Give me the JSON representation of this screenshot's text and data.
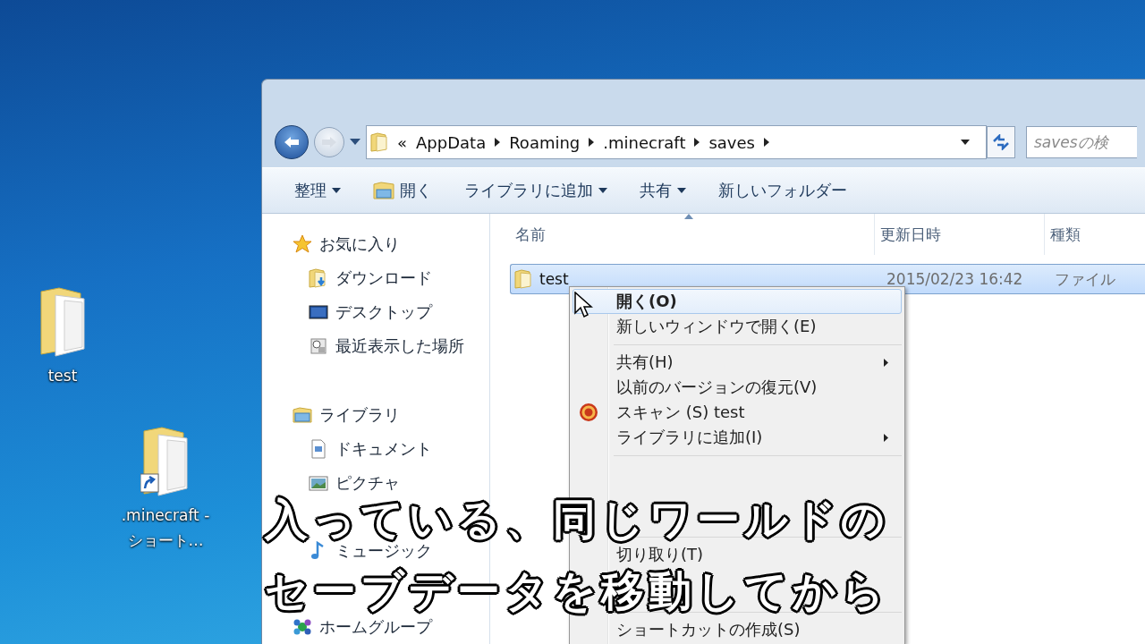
{
  "desktop": {
    "icons": [
      {
        "label": "test",
        "kind": "folder"
      },
      {
        "label": ".minecraft - ショート…",
        "kind": "shortcut"
      }
    ]
  },
  "explorer": {
    "back": {
      "disabled": false
    },
    "forward": {
      "disabled": true
    },
    "address": {
      "overflow": "«",
      "crumbs": [
        "AppData",
        "Roaming",
        ".minecraft",
        "saves"
      ]
    },
    "search": {
      "placeholder": "savesの検"
    },
    "toolbar": [
      {
        "label": "整理",
        "kind": "menu"
      },
      {
        "label": "開く",
        "kind": "open"
      },
      {
        "label": "ライブラリに追加",
        "kind": "menu"
      },
      {
        "label": "共有",
        "kind": "menu"
      },
      {
        "label": "新しいフォルダー",
        "kind": "plain"
      }
    ],
    "nav_pane": [
      {
        "label": "お気に入り",
        "kind": "favorites",
        "children": [
          {
            "label": "ダウンロード",
            "kind": "downloads"
          },
          {
            "label": "デスクトップ",
            "kind": "desktop"
          },
          {
            "label": "最近表示した場所",
            "kind": "recent"
          }
        ]
      },
      {
        "label": "ライブラリ",
        "kind": "libraries",
        "children": [
          {
            "label": "ドキュメント",
            "kind": "documents"
          },
          {
            "label": "ピクチャ",
            "kind": "pictures"
          },
          {
            "kind": "covered"
          },
          {
            "label": "ミュージック",
            "kind": "music"
          }
        ]
      },
      {
        "label": "ホームグループ",
        "kind": "homegroup"
      }
    ],
    "columns": [
      {
        "label": "名前",
        "sorted": true
      },
      {
        "label": "更新日時",
        "sorted": false
      },
      {
        "label": "種類",
        "sorted": false
      }
    ],
    "rows": [
      {
        "name": "test",
        "modified": "2015/02/23 16:42",
        "type": "ファイル",
        "selected": true
      }
    ]
  },
  "context_menu": {
    "items": [
      {
        "kind": "item",
        "label": "開く(O)",
        "default": true,
        "selected": true,
        "submenu": false,
        "has_icon": false
      },
      {
        "kind": "item",
        "label": "新しいウィンドウで開く(E)",
        "default": false,
        "selected": false,
        "submenu": false,
        "has_icon": false
      },
      {
        "kind": "separator"
      },
      {
        "kind": "item",
        "label": "共有(H)",
        "default": false,
        "selected": false,
        "submenu": true,
        "has_icon": false
      },
      {
        "kind": "item",
        "label": "以前のバージョンの復元(V)",
        "default": false,
        "selected": false,
        "submenu": false,
        "has_icon": false
      },
      {
        "kind": "item",
        "label": "スキャン (S) test",
        "default": false,
        "selected": false,
        "submenu": false,
        "has_icon": true
      },
      {
        "kind": "item",
        "label": "ライブラリに追加(I)",
        "default": false,
        "selected": false,
        "submenu": true,
        "has_icon": false
      },
      {
        "kind": "separator"
      },
      {
        "kind": "covered"
      },
      {
        "kind": "separator"
      },
      {
        "kind": "item",
        "label": "切り取り(T)",
        "default": false,
        "selected": false,
        "submenu": false,
        "has_icon": false
      },
      {
        "kind": "covered"
      },
      {
        "kind": "separator"
      },
      {
        "kind": "item",
        "label": "ショートカットの作成(S)",
        "default": false,
        "selected": false,
        "submenu": false,
        "has_icon": false
      }
    ]
  },
  "subtitle": {
    "lines": [
      "入っている、同じワールドの",
      "セーブデータを移動してから"
    ]
  }
}
